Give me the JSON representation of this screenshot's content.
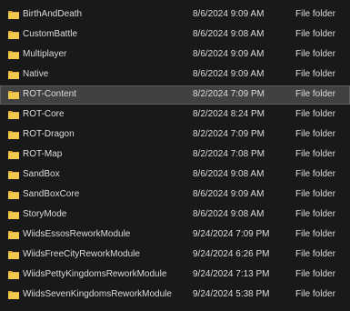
{
  "file_list": {
    "rows": [
      {
        "name": "BirthAndDeath",
        "date": "8/6/2024 9:09 AM",
        "type": "File folder",
        "selected": false
      },
      {
        "name": "CustomBattle",
        "date": "8/6/2024 9:08 AM",
        "type": "File folder",
        "selected": false
      },
      {
        "name": "Multiplayer",
        "date": "8/6/2024 9:09 AM",
        "type": "File folder",
        "selected": false
      },
      {
        "name": "Native",
        "date": "8/6/2024 9:09 AM",
        "type": "File folder",
        "selected": false
      },
      {
        "name": "ROT-Content",
        "date": "8/2/2024 7:09 PM",
        "type": "File folder",
        "selected": true
      },
      {
        "name": "ROT-Core",
        "date": "8/2/2024 8:24 PM",
        "type": "File folder",
        "selected": false
      },
      {
        "name": "ROT-Dragon",
        "date": "8/2/2024 7:09 PM",
        "type": "File folder",
        "selected": false
      },
      {
        "name": "ROT-Map",
        "date": "8/2/2024 7:08 PM",
        "type": "File folder",
        "selected": false
      },
      {
        "name": "SandBox",
        "date": "8/6/2024 9:08 AM",
        "type": "File folder",
        "selected": false
      },
      {
        "name": "SandBoxCore",
        "date": "8/6/2024 9:09 AM",
        "type": "File folder",
        "selected": false
      },
      {
        "name": "StoryMode",
        "date": "8/6/2024 9:08 AM",
        "type": "File folder",
        "selected": false
      },
      {
        "name": "WiidsEssosReworkModule",
        "date": "9/24/2024 7:09 PM",
        "type": "File folder",
        "selected": false
      },
      {
        "name": "WiidsFreeCityReworkModule",
        "date": "9/24/2024 6:26 PM",
        "type": "File folder",
        "selected": false
      },
      {
        "name": "WiidsPettyKingdomsReworkModule",
        "date": "9/24/2024 7:13 PM",
        "type": "File folder",
        "selected": false
      },
      {
        "name": "WiidsSevenKingdomsReworkModule",
        "date": "9/24/2024 5:38 PM",
        "type": "File folder",
        "selected": false
      }
    ]
  },
  "icons": {
    "row_icon": "folder-icon"
  },
  "colors": {
    "background": "#191919",
    "text": "#dcdcdc",
    "selected_row": "#414141",
    "folder": "#f2c94c"
  }
}
